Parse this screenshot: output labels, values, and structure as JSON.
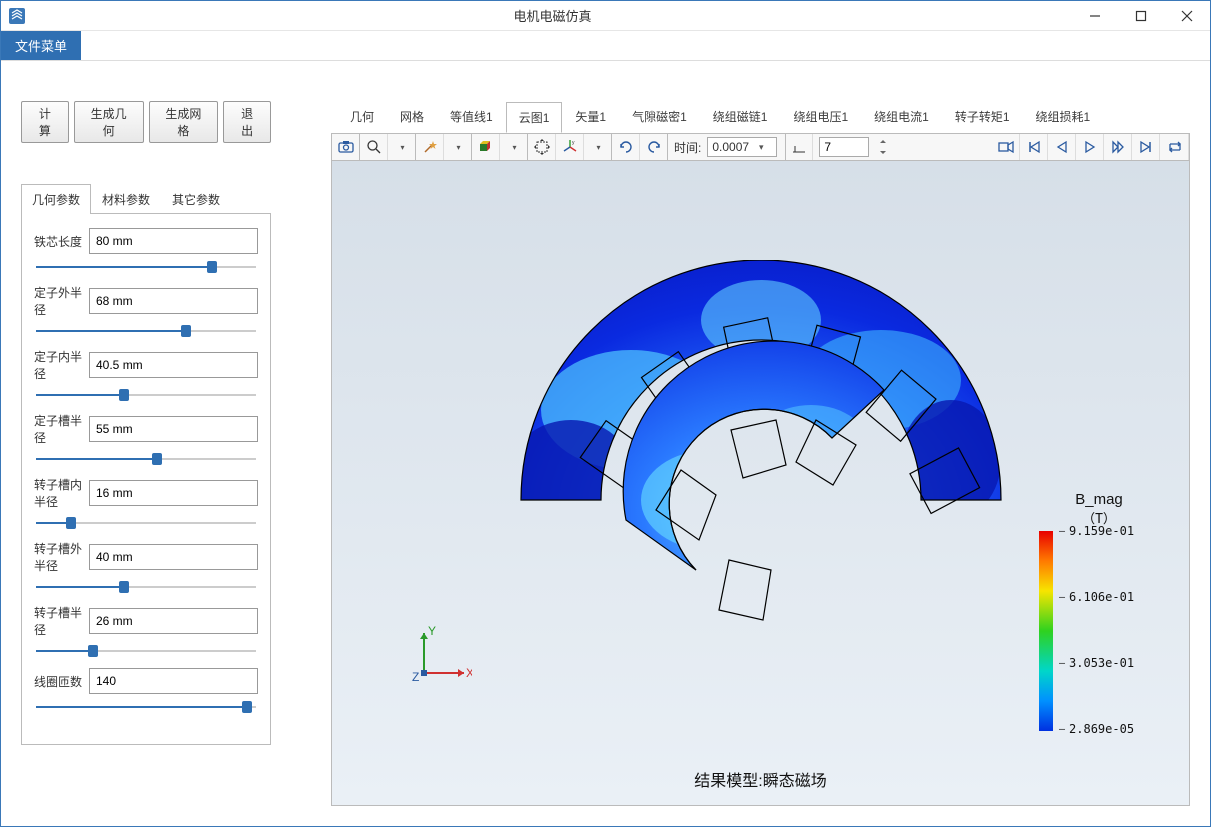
{
  "window": {
    "title": "电机电磁仿真"
  },
  "menubar": {
    "file_menu": "文件菜单"
  },
  "buttons": {
    "compute": "计算",
    "gen_geometry": "生成几何",
    "gen_mesh": "生成网格",
    "exit": "退出"
  },
  "param_tabs": [
    "几何参数",
    "材料参数",
    "其它参数"
  ],
  "params": [
    {
      "label": "铁芯长度",
      "value": "80 mm",
      "pct": 80
    },
    {
      "label": "定子外半径",
      "value": "68 mm",
      "pct": 68
    },
    {
      "label": "定子内半径",
      "value": "40.5 mm",
      "pct": 40
    },
    {
      "label": "定子槽半径",
      "value": "55 mm",
      "pct": 55
    },
    {
      "label": "转子槽内半径",
      "value": "16 mm",
      "pct": 16
    },
    {
      "label": "转子槽外半径",
      "value": "40 mm",
      "pct": 40
    },
    {
      "label": "转子槽半径",
      "value": "26 mm",
      "pct": 26
    },
    {
      "label": "线圈匝数",
      "value": "140",
      "pct": 96
    }
  ],
  "plot_tabs": [
    "几何",
    "网格",
    "等值线1",
    "云图1",
    "矢量1",
    "气隙磁密1",
    "绕组磁链1",
    "绕组电压1",
    "绕组电流1",
    "转子转矩1",
    "绕组损耗1"
  ],
  "plot_active_tab": 3,
  "toolbar": {
    "time_label": "时间:",
    "time_value": "0.0007",
    "frame_value": "7"
  },
  "legend": {
    "title": "B_mag",
    "unit": "（T）",
    "ticks": [
      {
        "val": "9.159e-01",
        "pos": 0
      },
      {
        "val": "6.106e-01",
        "pos": 33
      },
      {
        "val": "3.053e-01",
        "pos": 66
      },
      {
        "val": "2.869e-05",
        "pos": 99
      }
    ]
  },
  "footer": "结果模型:瞬态磁场",
  "axes": {
    "x": "X",
    "y": "Y",
    "z": "Z"
  },
  "chart_data": {
    "type": "heatmap",
    "title": "结果模型:瞬态磁场",
    "field": "B_mag",
    "unit": "T",
    "colormap_range": [
      2.869e-05,
      0.9159
    ],
    "legend_ticks": [
      0.9159,
      0.6106,
      0.3053,
      2.869e-05
    ],
    "time": 0.0007,
    "frame": 7,
    "description": "Contour/cloud plot of magnetic flux density magnitude over a half-section of an electric motor (stator + rotor) geometry at a single time step.",
    "geometry": "half annular motor cross-section with stator slots and rotor poles"
  }
}
